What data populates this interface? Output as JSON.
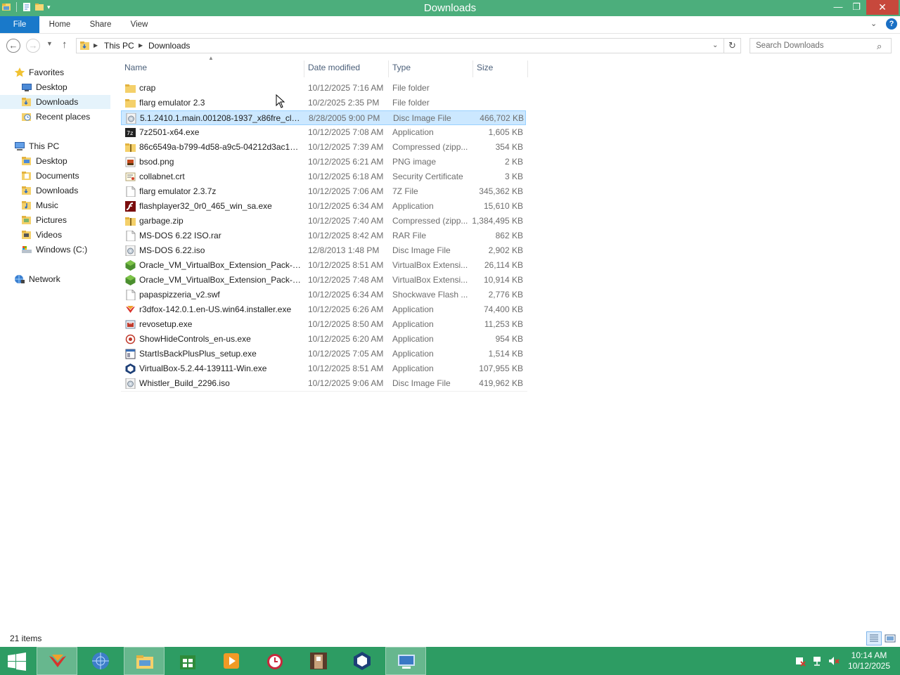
{
  "window": {
    "title": "Downloads",
    "minimize_icon": "minimize-icon",
    "maximize_icon": "restore-icon",
    "close_icon": "close-icon"
  },
  "ribbon": {
    "tabs": [
      "File",
      "Home",
      "Share",
      "View"
    ],
    "active_tab": "File",
    "active_color": "#1979ca",
    "help_label": "?"
  },
  "address_bar": {
    "crumbs": [
      "This PC",
      "Downloads"
    ]
  },
  "search": {
    "placeholder": "Search Downloads"
  },
  "sidebar": {
    "items": [
      {
        "label": "Favorites",
        "icon": "star-icon"
      },
      {
        "label": "Desktop",
        "icon": "desktop-icon"
      },
      {
        "label": "Downloads",
        "icon": "downloads-folder-icon",
        "selected": true
      },
      {
        "label": "Recent places",
        "icon": "recent-places-icon"
      },
      {
        "label": "This PC",
        "icon": "computer-icon"
      },
      {
        "label": "Desktop",
        "icon": "folder-icon"
      },
      {
        "label": "Documents",
        "icon": "folder-icon"
      },
      {
        "label": "Downloads",
        "icon": "folder-icon"
      },
      {
        "label": "Music",
        "icon": "folder-icon"
      },
      {
        "label": "Pictures",
        "icon": "folder-icon"
      },
      {
        "label": "Videos",
        "icon": "folder-icon"
      },
      {
        "label": "Windows (C:)",
        "icon": "drive-icon"
      },
      {
        "label": "Network",
        "icon": "network-icon"
      }
    ]
  },
  "columns": [
    "Name",
    "Date modified",
    "Type",
    "Size"
  ],
  "files": [
    {
      "name": "crap",
      "date": "10/12/2025 7:16 AM",
      "type": "File folder",
      "size": "",
      "icon": "folder-icon"
    },
    {
      "name": "flarg emulator 2.3",
      "date": "10/2/2025 2:35 PM",
      "type": "File folder",
      "size": "",
      "icon": "folder-icon"
    },
    {
      "name": "5.1.2410.1.main.001208-1937_x86fre_clien...",
      "date": "8/28/2005 9:00 PM",
      "type": "Disc Image File",
      "size": "466,702 KB",
      "icon": "disc-image-icon",
      "selected": true
    },
    {
      "name": "7z2501-x64.exe",
      "date": "10/12/2025 7:08 AM",
      "type": "Application",
      "size": "1,605 KB",
      "icon": "7zip-icon"
    },
    {
      "name": "86c6549a-b799-4d58-a9c5-04212d3ac17e...",
      "date": "10/12/2025 7:39 AM",
      "type": "Compressed (zipp...",
      "size": "354 KB",
      "icon": "zip-folder-icon"
    },
    {
      "name": "bsod.png",
      "date": "10/12/2025 6:21 AM",
      "type": "PNG image",
      "size": "2 KB",
      "icon": "image-file-icon"
    },
    {
      "name": "collabnet.crt",
      "date": "10/12/2025 6:18 AM",
      "type": "Security Certificate",
      "size": "3 KB",
      "icon": "certificate-icon"
    },
    {
      "name": "flarg emulator 2.3.7z",
      "date": "10/12/2025 7:06 AM",
      "type": "7Z File",
      "size": "345,362 KB",
      "icon": "blank-file-icon"
    },
    {
      "name": "flashplayer32_0r0_465_win_sa.exe",
      "date": "10/12/2025 6:34 AM",
      "type": "Application",
      "size": "15,610 KB",
      "icon": "flash-icon"
    },
    {
      "name": "garbage.zip",
      "date": "10/12/2025 7:40 AM",
      "type": "Compressed (zipp...",
      "size": "1,384,495 KB",
      "icon": "zip-folder-icon"
    },
    {
      "name": "MS-DOS 6.22 ISO.rar",
      "date": "10/12/2025 8:42 AM",
      "type": "RAR File",
      "size": "862 KB",
      "icon": "blank-file-icon"
    },
    {
      "name": "MS-DOS 6.22.iso",
      "date": "12/8/2013 1:48 PM",
      "type": "Disc Image File",
      "size": "2,902 KB",
      "icon": "disc-image-icon"
    },
    {
      "name": "Oracle_VM_VirtualBox_Extension_Pack-5....",
      "date": "10/12/2025 8:51 AM",
      "type": "VirtualBox Extensi...",
      "size": "26,114 KB",
      "icon": "virtualbox-extension-icon"
    },
    {
      "name": "Oracle_VM_VirtualBox_Extension_Pack-6....",
      "date": "10/12/2025 7:48 AM",
      "type": "VirtualBox Extensi...",
      "size": "10,914 KB",
      "icon": "virtualbox-extension-icon"
    },
    {
      "name": "papaspizzeria_v2.swf",
      "date": "10/12/2025 6:34 AM",
      "type": "Shockwave Flash ...",
      "size": "2,776 KB",
      "icon": "blank-file-icon"
    },
    {
      "name": "r3dfox-142.0.1.en-US.win64.installer.exe",
      "date": "10/12/2025 6:26 AM",
      "type": "Application",
      "size": "74,400 KB",
      "icon": "r3dfox-icon"
    },
    {
      "name": "revosetup.exe",
      "date": "10/12/2025 8:50 AM",
      "type": "Application",
      "size": "11,253 KB",
      "icon": "installer-icon"
    },
    {
      "name": "ShowHideControls_en-us.exe",
      "date": "10/12/2025 6:20 AM",
      "type": "Application",
      "size": "954 KB",
      "icon": "app-icon"
    },
    {
      "name": "StartIsBackPlusPlus_setup.exe",
      "date": "10/12/2025 7:05 AM",
      "type": "Application",
      "size": "1,514 KB",
      "icon": "app-window-icon"
    },
    {
      "name": "VirtualBox-5.2.44-139111-Win.exe",
      "date": "10/12/2025 8:51 AM",
      "type": "Application",
      "size": "107,955 KB",
      "icon": "virtualbox-icon"
    },
    {
      "name": "Whistler_Build_2296.iso",
      "date": "10/12/2025 9:06 AM",
      "type": "Disc Image File",
      "size": "419,962 KB",
      "icon": "disc-image-icon"
    }
  ],
  "status": {
    "item_count": "21 items"
  },
  "taskbar": {
    "color": "#2d9c63",
    "apps": [
      {
        "icon": "r3dfox-icon",
        "active": true
      },
      {
        "icon": "globe-browser-icon",
        "active": false
      },
      {
        "icon": "file-explorer-icon",
        "active": true
      },
      {
        "icon": "store-icon",
        "active": false
      },
      {
        "icon": "media-player-icon",
        "active": false
      },
      {
        "icon": "alarm-clock-icon",
        "active": false
      },
      {
        "icon": "game-icon",
        "active": false
      },
      {
        "icon": "virtualbox-icon",
        "active": false
      },
      {
        "icon": "remote-desktop-icon",
        "active": true
      }
    ],
    "tray": [
      "action-center-icon",
      "network-icon",
      "volume-muted-icon"
    ],
    "clock_time": "10:14 AM",
    "clock_date": "10/12/2025"
  }
}
